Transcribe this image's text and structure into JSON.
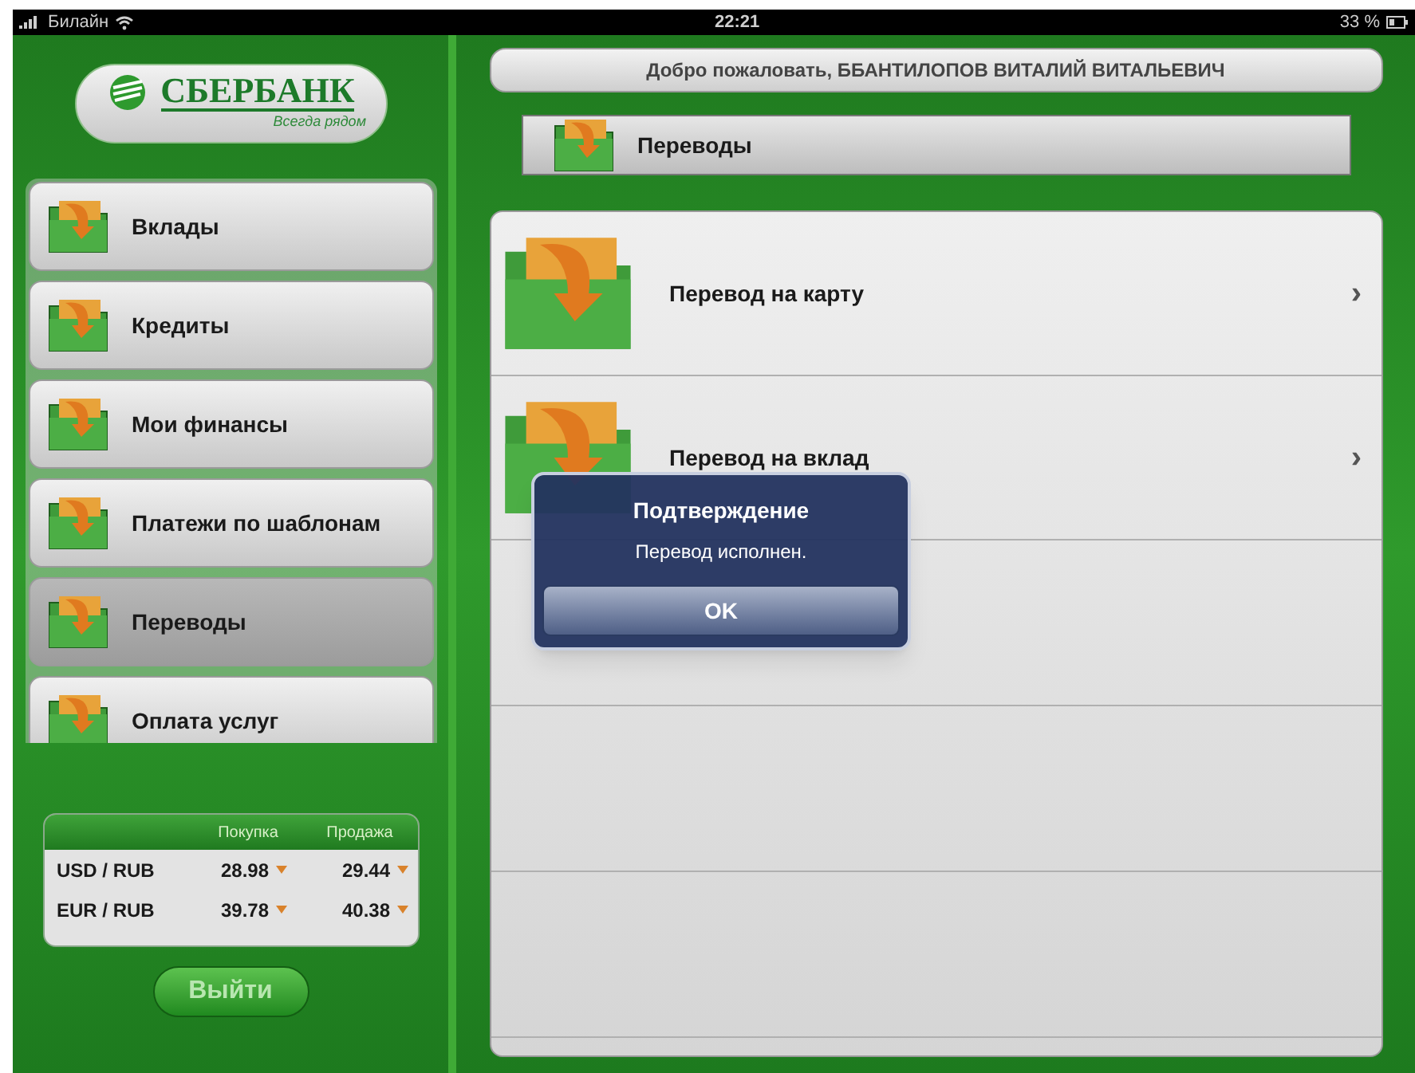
{
  "status_bar": {
    "carrier": "Билайн",
    "time": "22:21",
    "battery": "33 %"
  },
  "logo": {
    "name": "СБЕРБАНК",
    "slogan": "Всегда рядом"
  },
  "menu": [
    {
      "label": "Вклады",
      "selected": false
    },
    {
      "label": "Кредиты",
      "selected": false
    },
    {
      "label": "Мои финансы",
      "selected": false
    },
    {
      "label": "Платежи по шаблонам",
      "selected": false
    },
    {
      "label": "Переводы",
      "selected": true
    },
    {
      "label": "Оплата услуг",
      "selected": false
    }
  ],
  "rates": {
    "columns": [
      "Покупка",
      "Продажа"
    ],
    "rows": [
      {
        "pair": "USD / RUB",
        "buy": "28.98",
        "sell": "29.44"
      },
      {
        "pair": "EUR / RUB",
        "buy": "39.78",
        "sell": "40.38"
      }
    ]
  },
  "logout": "Выйти",
  "welcome": "Добро пожаловать, ББАНТИЛОПОВ ВИТАЛИЙ ВИТАЛЬЕВИЧ",
  "section": "Переводы",
  "list": [
    {
      "label": "Перевод на карту",
      "chevron": "›"
    },
    {
      "label": "Перевод на вклад",
      "chevron": "›"
    }
  ],
  "dialog": {
    "title": "Подтверждение",
    "message": "Перевод исполнен.",
    "button": "OK"
  }
}
